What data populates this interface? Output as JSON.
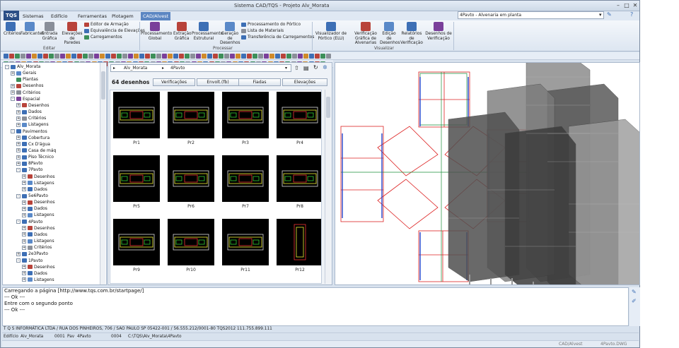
{
  "app": {
    "title": "Sistema CAD/TQS - Projeto Alv_Morata",
    "logo": "TQS"
  },
  "menu": [
    "Sistemas",
    "Edifício",
    "Ferramentas",
    "Plotagem",
    "CAD/Alvest"
  ],
  "doc_selector": "4Pavto - Alvenaria em planta",
  "ribbon": {
    "editar": {
      "label": "Editar",
      "buttons": [
        {
          "name": "criterios",
          "label": "Critérios",
          "color": "#3d6fb5"
        },
        {
          "name": "fabricantes",
          "label": "Fabricantes",
          "color": "#5a89c8"
        },
        {
          "name": "entrada-grafica",
          "label": "Entrada Gráfica",
          "color": "#8a8f99"
        },
        {
          "name": "elevacoes",
          "label": "Elevações de Paredes",
          "color": "#b8433a"
        }
      ],
      "small": [
        {
          "name": "editor-armacao",
          "label": "Editor de Armação",
          "color": "#b8433a"
        },
        {
          "name": "equivalencia",
          "label": "Equivalência de Elevações",
          "color": "#3d6fb5"
        },
        {
          "name": "carregamentos",
          "label": "Carregamentos",
          "color": "#3d8f5a"
        }
      ]
    },
    "processar": {
      "label": "Processar",
      "buttons": [
        {
          "name": "processamento-global",
          "label": "Processamento Global",
          "color": "#7a3f9a"
        },
        {
          "name": "extracao-grafica",
          "label": "Extração Gráfica",
          "color": "#b8433a"
        },
        {
          "name": "processamento-estrutural",
          "label": "Processamento Estrutural",
          "color": "#3d6fb5"
        },
        {
          "name": "geracao-desenhos",
          "label": "Geração de Desenhos",
          "color": "#5a89c8"
        }
      ],
      "small": [
        {
          "name": "processamento-portico",
          "label": "Processamento do Pórtico",
          "color": "#3d6fb5"
        },
        {
          "name": "lista-materiais",
          "label": "Lista de Materiais",
          "color": "#8a8f99"
        },
        {
          "name": "transferencia",
          "label": "Transferência de Carregamentos",
          "color": "#3d6fb5"
        }
      ]
    },
    "visualizar": {
      "label": "Visualizar",
      "buttons": [
        {
          "name": "visualizador-portico",
          "label": "Visualizador de Pórtico (ELU)",
          "color": "#3d6fb5"
        },
        {
          "name": "verificacao-grafica",
          "label": "Verificação Gráfica de Alvenarias",
          "color": "#b8433a"
        },
        {
          "name": "edicao-desenhos",
          "label": "Edição de Desenhos",
          "color": "#5a89c8"
        },
        {
          "name": "relatorios",
          "label": "Relatórios de Verificação",
          "color": "#3d6fb5"
        },
        {
          "name": "desenhos-verificacao",
          "label": "Desenhos de Verificação",
          "color": "#7a3f9a"
        }
      ]
    }
  },
  "tree": [
    {
      "label": "Alv_Morata",
      "level": 0,
      "ex": "-",
      "color": "#3d6fb5"
    },
    {
      "label": "Gerais",
      "level": 1,
      "ex": "+",
      "color": "#5a89c8"
    },
    {
      "label": "Plantas",
      "level": 1,
      "ex": "",
      "color": "#3d8f5a"
    },
    {
      "label": "Desenhos",
      "level": 1,
      "ex": "+",
      "color": "#b8433a"
    },
    {
      "label": "Critérios",
      "level": 1,
      "ex": "+",
      "color": "#8a8f99"
    },
    {
      "label": "Espacial",
      "level": 1,
      "ex": "-",
      "color": "#7a3f9a"
    },
    {
      "label": "Desenhos",
      "level": 2,
      "ex": "+",
      "color": "#b8433a"
    },
    {
      "label": "Dados",
      "level": 2,
      "ex": "+",
      "color": "#3d6fb5"
    },
    {
      "label": "Critérios",
      "level": 2,
      "ex": "+",
      "color": "#8a8f99"
    },
    {
      "label": "Listagens",
      "level": 2,
      "ex": "+",
      "color": "#5a89c8"
    },
    {
      "label": "Pavimentos",
      "level": 1,
      "ex": "-",
      "color": "#3d6fb5"
    },
    {
      "label": "Cobertura",
      "level": 2,
      "ex": "+",
      "color": "#3d6fb5"
    },
    {
      "label": "Cx D'água",
      "level": 2,
      "ex": "+",
      "color": "#3d6fb5"
    },
    {
      "label": "Casa de máq",
      "level": 2,
      "ex": "+",
      "color": "#3d6fb5"
    },
    {
      "label": "Piso Técnico",
      "level": 2,
      "ex": "+",
      "color": "#3d6fb5"
    },
    {
      "label": "8Pavto",
      "level": 2,
      "ex": "+",
      "color": "#3d6fb5"
    },
    {
      "label": "7Pavto",
      "level": 2,
      "ex": "-",
      "color": "#3d6fb5"
    },
    {
      "label": "Desenhos",
      "level": 3,
      "ex": "+",
      "color": "#b8433a"
    },
    {
      "label": "Listagens",
      "level": 3,
      "ex": "+",
      "color": "#5a89c8"
    },
    {
      "label": "Dados",
      "level": 3,
      "ex": "+",
      "color": "#3d6fb5"
    },
    {
      "label": "5e6Pavto",
      "level": 2,
      "ex": "-",
      "color": "#3d6fb5"
    },
    {
      "label": "Desenhos",
      "level": 3,
      "ex": "+",
      "color": "#b8433a"
    },
    {
      "label": "Dados",
      "level": 3,
      "ex": "+",
      "color": "#3d6fb5"
    },
    {
      "label": "Listagens",
      "level": 3,
      "ex": "+",
      "color": "#5a89c8"
    },
    {
      "label": "4Pavto",
      "level": 2,
      "ex": "-",
      "color": "#3d6fb5"
    },
    {
      "label": "Desenhos",
      "level": 3,
      "ex": "+",
      "color": "#b8433a"
    },
    {
      "label": "Dados",
      "level": 3,
      "ex": "+",
      "color": "#3d6fb5"
    },
    {
      "label": "Listagens",
      "level": 3,
      "ex": "+",
      "color": "#5a89c8"
    },
    {
      "label": "Critérios",
      "level": 3,
      "ex": "+",
      "color": "#8a8f99"
    },
    {
      "label": "2e3Pavto",
      "level": 2,
      "ex": "+",
      "color": "#3d6fb5"
    },
    {
      "label": "1Pavto",
      "level": 2,
      "ex": "-",
      "color": "#3d6fb5"
    },
    {
      "label": "Desenhos",
      "level": 3,
      "ex": "+",
      "color": "#b8433a"
    },
    {
      "label": "Dados",
      "level": 3,
      "ex": "+",
      "color": "#3d6fb5"
    },
    {
      "label": "Listagens",
      "level": 3,
      "ex": "+",
      "color": "#5a89c8"
    }
  ],
  "browser": {
    "path": [
      "Alv_Morata",
      "4Pavto"
    ],
    "count_label": "64 desenhos",
    "filters": [
      "Verificações",
      "Envolt.(fb)",
      "Fiadas",
      "Elevações"
    ],
    "drawings": [
      "Pr1",
      "Pr2",
      "Pr3",
      "Pr4",
      "Pr5",
      "Pr6",
      "Pr7",
      "Pr8",
      "Pr9",
      "Pr10",
      "Pr11",
      "Pr12"
    ]
  },
  "console": {
    "lines": [
      "Carregando a página [http://www.tqs.com.br/startpage/]",
      "--- Ok ---",
      "Entre com o segundo ponto",
      "--- Ok ---"
    ]
  },
  "company_line": "T Q S  INFORMÁTICA LTDA / RUA DOS PINHEIROS, 706 / SAO PAULO SP 05422-001 / 56.555.212/0001-80 TQS2012 111.755.899.111",
  "status": {
    "edificio_label": "Edifício",
    "edificio": "Alv_Morata",
    "num1": "0001",
    "pav_label": "Pav",
    "pav": "4Pavto",
    "num2": "0004",
    "path": "C:\\TQS\\Alv_Morata\\4Pavto",
    "mode": "CAD/Alvest",
    "file": "4Pavto.DWG"
  }
}
